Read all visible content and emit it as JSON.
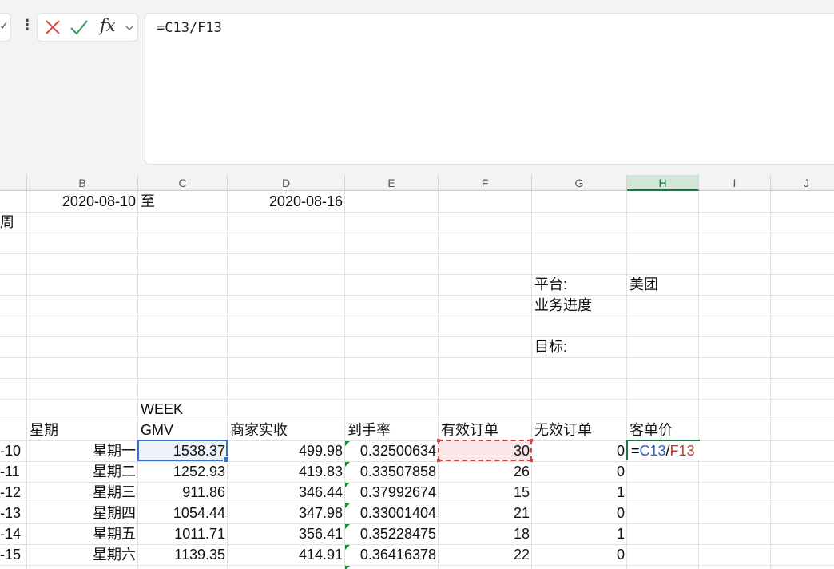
{
  "formula_bar": {
    "formula": "=C13/F13",
    "icons": {
      "cancel": "cancel-x-icon",
      "confirm": "confirm-check-icon",
      "function": "fx-icon",
      "expand": "chevron-down-icon",
      "more": "more-vertical-icon"
    },
    "fx_label": "fx"
  },
  "columns": [
    "B",
    "C",
    "D",
    "E",
    "F",
    "G",
    "H",
    "I",
    "J"
  ],
  "active_column": "H",
  "header_cells": {
    "b1": "2020-08-10",
    "c1": "至",
    "d1": "2020-08-16",
    "a2": "周",
    "g5": "平台:",
    "h5": "美团",
    "g6": "业务进度",
    "g8": "目标:",
    "c11": "WEEK"
  },
  "table": {
    "headers": {
      "b": "星期",
      "c": "GMV",
      "d": "商家实收",
      "e": "到手率",
      "f": "有效订单",
      "g": "无效订单",
      "h": "客单价"
    },
    "rows": [
      {
        "a": "-10",
        "weekday": "星期一",
        "gmv": "1538.37",
        "received": "499.98",
        "rate": "0.32500634",
        "valid": "30",
        "invalid": "0"
      },
      {
        "a": "-11",
        "weekday": "星期二",
        "gmv": "1252.93",
        "received": "419.83",
        "rate": "0.33507858",
        "valid": "26",
        "invalid": "0"
      },
      {
        "a": "-12",
        "weekday": "星期三",
        "gmv": "911.86",
        "received": "346.44",
        "rate": "0.37992674",
        "valid": "15",
        "invalid": "1"
      },
      {
        "a": "-13",
        "weekday": "星期四",
        "gmv": "1054.44",
        "received": "347.98",
        "rate": "0.33001404",
        "valid": "21",
        "invalid": "0"
      },
      {
        "a": "-14",
        "weekday": "星期五",
        "gmv": "1011.71",
        "received": "356.41",
        "rate": "0.35228475",
        "valid": "18",
        "invalid": "1"
      },
      {
        "a": "-15",
        "weekday": "星期六",
        "gmv": "1139.35",
        "received": "414.91",
        "rate": "0.36416378",
        "valid": "22",
        "invalid": "0"
      }
    ]
  },
  "editing": {
    "eq": "=",
    "ref1": "C13",
    "op": "/",
    "ref2": "F13"
  },
  "colors": {
    "accent_green": "#217346",
    "ref_blue": "#2f5fbf",
    "ref_red": "#c0392b"
  }
}
